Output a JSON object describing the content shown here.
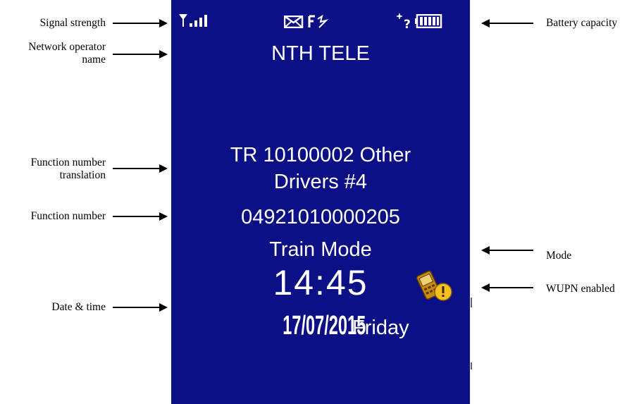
{
  "labels": {
    "signal_strength": "Signal strength",
    "network_operator_line1": "Network operator",
    "network_operator_line2": "name",
    "function_translation_line1": "Function number",
    "function_translation_line2": "translation",
    "function_number": "Function number",
    "date_time": "Date & time",
    "battery_capacity": "Battery capacity",
    "mode": "Mode",
    "wupn_enabled": "WUPN enabled"
  },
  "screen": {
    "operator": "NTH TELE",
    "translation_line1": "TR 10100002  Other",
    "translation_line2": "Drivers #4",
    "function_number": "04921010000205",
    "mode": "Train Mode",
    "time": "14:45",
    "date": "17/07/2015",
    "weekday": "Friday"
  },
  "status_icons": [
    "signal-icon",
    "message-icon",
    "forwarding-icon",
    "gps-unknown-icon",
    "battery-icon"
  ],
  "colors": {
    "screen_background": "#0b1087",
    "screen_text": "#ffffff",
    "wupn_icon": "#e0a020"
  }
}
